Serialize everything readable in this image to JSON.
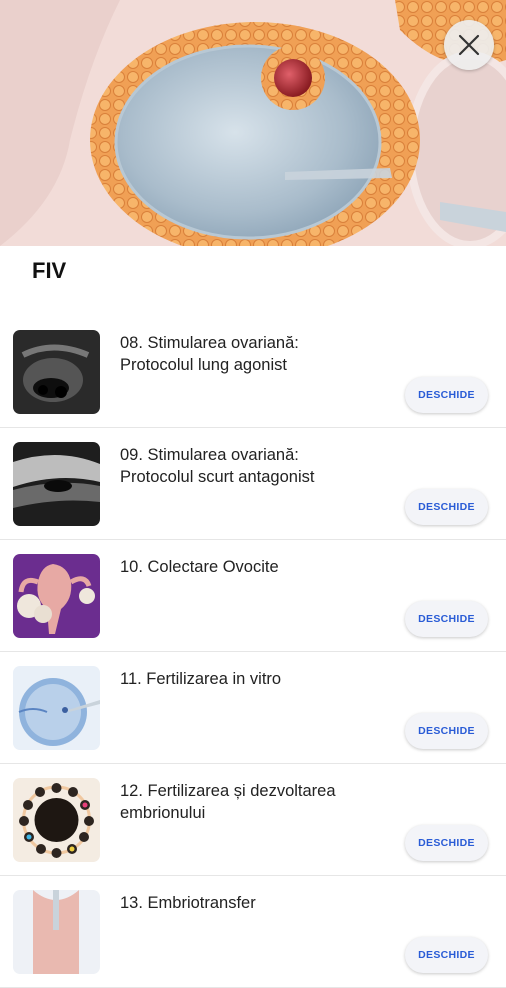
{
  "page": {
    "title": "FIV"
  },
  "close_icon": "close-icon",
  "items": [
    {
      "title": "08. Stimularea ovariană: Protocolul lung agonist",
      "button": "DESCHIDE",
      "thumb": "ultrasound-image"
    },
    {
      "title": "09. Stimularea ovariană: Protocolul scurt antagonist",
      "button": "DESCHIDE",
      "thumb": "ultrasound-image"
    },
    {
      "title": "10. Colectare Ovocite",
      "button": "DESCHIDE",
      "thumb": "uterus-illustration"
    },
    {
      "title": "11. Fertilizarea in vitro",
      "button": "DESCHIDE",
      "thumb": "egg-injection-illustration"
    },
    {
      "title": "12. Fertilizarea și dezvoltarea embrionului",
      "button": "DESCHIDE",
      "thumb": "embryo-ring-illustration"
    },
    {
      "title": "13. Embriotransfer",
      "button": "DESCHIDE",
      "thumb": "embryo-transfer-illustration"
    }
  ]
}
